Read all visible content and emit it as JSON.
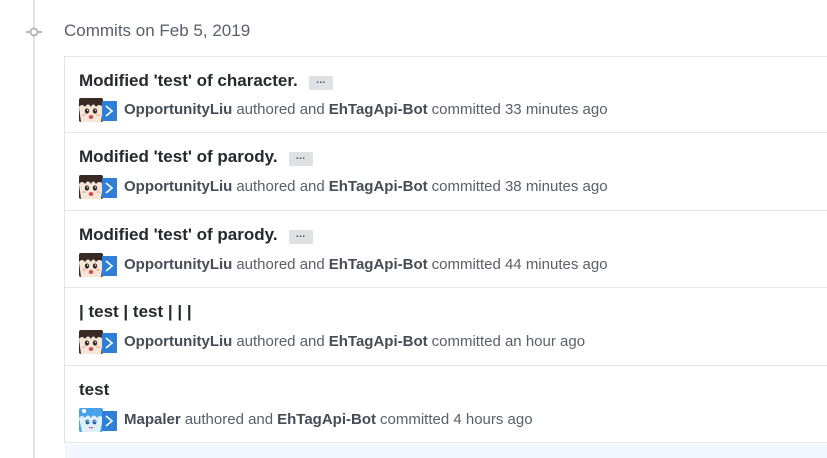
{
  "group": {
    "title": "Commits on Feb 5, 2019"
  },
  "commits": [
    {
      "title": "Modified 'test' of character.",
      "has_ellipsis": true,
      "ellipsis_label": "…",
      "author": "OpportunityLiu",
      "authored_text": "authored and",
      "committer": "EhTagApi-Bot",
      "committed_text": "committed 33 minutes ago",
      "avatar": "opportunityliu-avatar"
    },
    {
      "title": "Modified 'test' of parody.",
      "has_ellipsis": true,
      "ellipsis_label": "…",
      "author": "OpportunityLiu",
      "authored_text": "authored and",
      "committer": "EhTagApi-Bot",
      "committed_text": "committed 38 minutes ago",
      "avatar": "opportunityliu-avatar"
    },
    {
      "title": "Modified 'test' of parody.",
      "has_ellipsis": true,
      "ellipsis_label": "…",
      "author": "OpportunityLiu",
      "authored_text": "authored and",
      "committer": "EhTagApi-Bot",
      "committed_text": "committed 44 minutes ago",
      "avatar": "opportunityliu-avatar"
    },
    {
      "title": "| test | test | | |",
      "has_ellipsis": false,
      "author": "OpportunityLiu",
      "authored_text": "authored and",
      "committer": "EhTagApi-Bot",
      "committed_text": "committed an hour ago",
      "avatar": "opportunityliu-avatar"
    },
    {
      "title": "test",
      "has_ellipsis": false,
      "author": "Mapaler",
      "authored_text": "authored and",
      "committer": "EhTagApi-Bot",
      "committed_text": "committed 4 hours ago",
      "avatar": "mapaler-avatar"
    }
  ],
  "colors": {
    "border": "#e1e4e8",
    "bot_avatar": "#2f7fd6",
    "highlight_row": "#f1f8ff"
  }
}
